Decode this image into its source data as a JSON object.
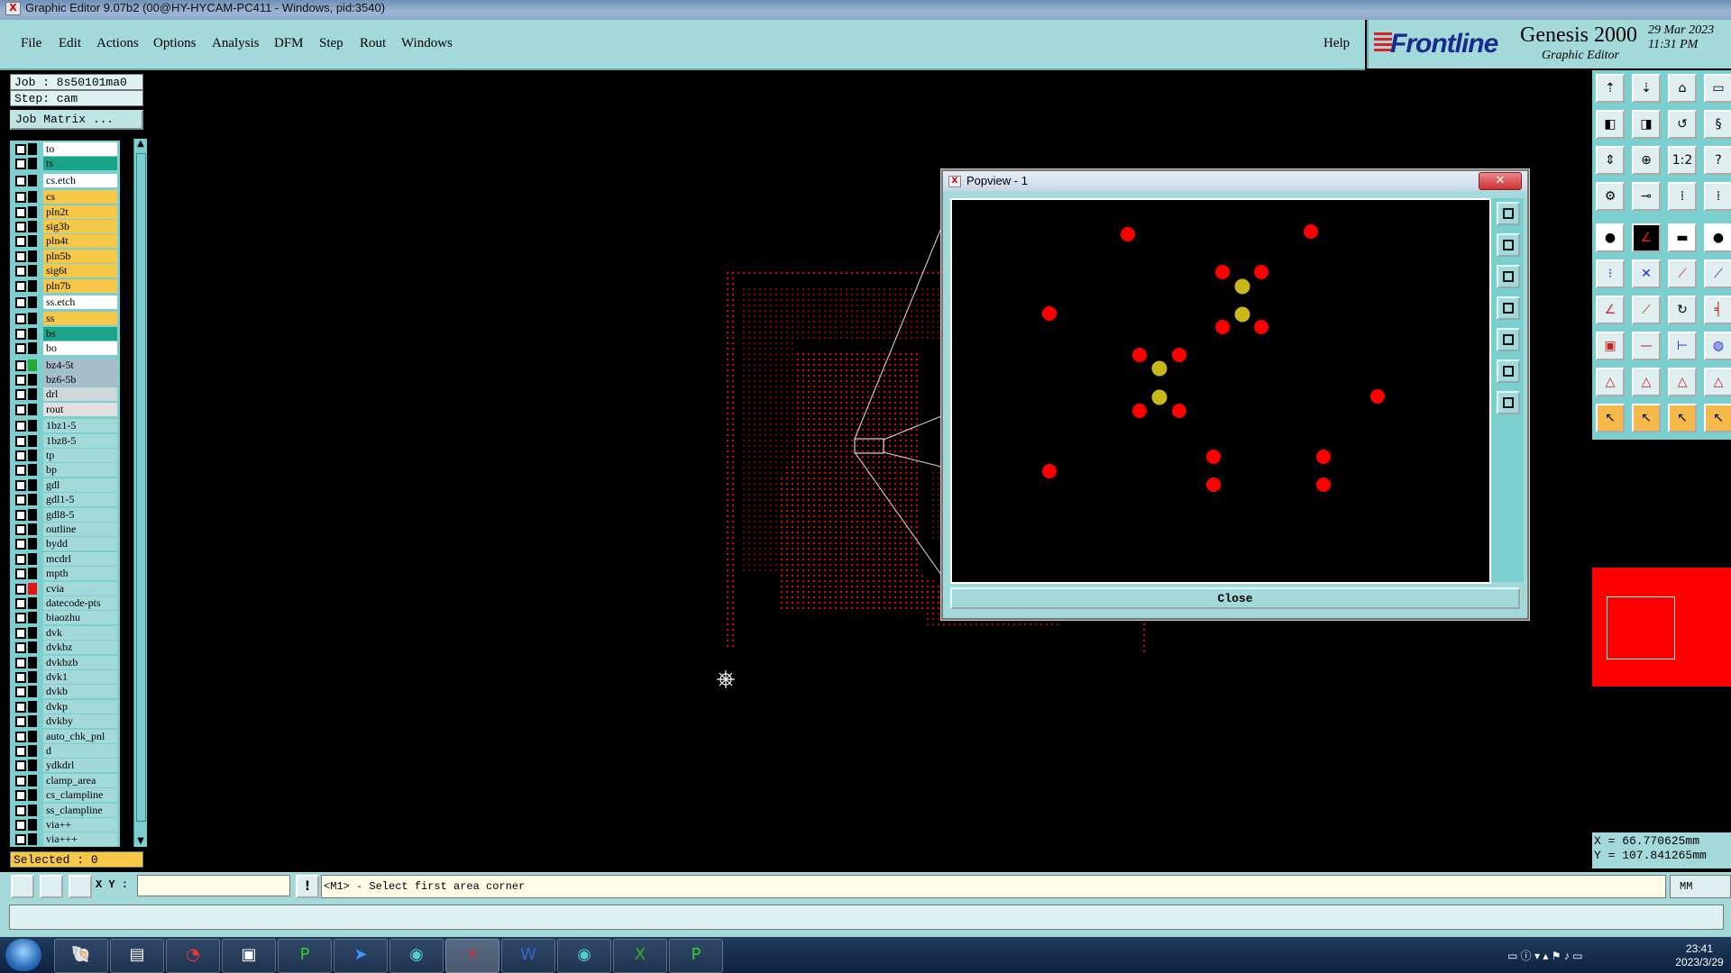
{
  "window": {
    "title": "Graphic Editor 9.07b2 (00@HY-HYCAM-PC411 - Windows, pid:3540)"
  },
  "menu": {
    "items": [
      "File",
      "Edit",
      "Actions",
      "Options",
      "Analysis",
      "DFM",
      "Step",
      "Rout",
      "Windows"
    ],
    "help": "Help"
  },
  "brand": {
    "logo": "Frontline",
    "product": "Genesis 2000",
    "subtitle": "Graphic Editor",
    "date": "29 Mar 2023",
    "time": "11:31 PM"
  },
  "job": {
    "job_label": "Job : 8s50101ma0",
    "step_label": "Step: cam",
    "matrix_button": "Job Matrix ..."
  },
  "layers": [
    {
      "name": "to",
      "color": "#ffffff"
    },
    {
      "name": "ts",
      "color": "#1aa58a"
    },
    {
      "name": "cs.etch",
      "color": "#ffffff",
      "gap": true
    },
    {
      "name": "cs",
      "color": "#f5c84a",
      "gap": true
    },
    {
      "name": "pln2t",
      "color": "#f5c84a"
    },
    {
      "name": "sig3b",
      "color": "#f5c84a"
    },
    {
      "name": "pln4t",
      "color": "#f5c84a"
    },
    {
      "name": "pln5b",
      "color": "#f5c84a"
    },
    {
      "name": "sig6t",
      "color": "#f5c84a"
    },
    {
      "name": "pln7b",
      "color": "#f5c84a"
    },
    {
      "name": "ss.etch",
      "color": "#ffffff",
      "gap": true
    },
    {
      "name": "ss",
      "color": "#f5c84a",
      "gap": true
    },
    {
      "name": "bs",
      "color": "#1aa58a"
    },
    {
      "name": "bo",
      "color": "#ffffff"
    },
    {
      "name": "bz4-5t",
      "color": "#a9bcc9",
      "gap": true,
      "swatch": "#22aa33"
    },
    {
      "name": "bz6-5b",
      "color": "#a9bcc9"
    },
    {
      "name": "drl",
      "color": "#cfd8d8"
    },
    {
      "name": "rout",
      "color": "#e0e0e0"
    },
    {
      "name": "1bz1-5",
      "color": "#a3d9d9",
      "gap": true
    },
    {
      "name": "1bz8-5",
      "color": "#a3d9d9"
    },
    {
      "name": "tp",
      "color": "#a3d9d9"
    },
    {
      "name": "bp",
      "color": "#a3d9d9"
    },
    {
      "name": "gdl",
      "color": "#a3d9d9"
    },
    {
      "name": "gdl1-5",
      "color": "#a3d9d9"
    },
    {
      "name": "gdl8-5",
      "color": "#a3d9d9"
    },
    {
      "name": "outline",
      "color": "#a3d9d9"
    },
    {
      "name": "bydd",
      "color": "#a3d9d9"
    },
    {
      "name": "mcdrl",
      "color": "#a3d9d9"
    },
    {
      "name": "mpth",
      "color": "#a3d9d9"
    },
    {
      "name": "cvia",
      "color": "#a3d9d9",
      "swatch": "#ee1111"
    },
    {
      "name": "datecode-pts",
      "color": "#a3d9d9"
    },
    {
      "name": "biaozhu",
      "color": "#a3d9d9"
    },
    {
      "name": "dvk",
      "color": "#a3d9d9"
    },
    {
      "name": "dvkbz",
      "color": "#a3d9d9"
    },
    {
      "name": "dvkbzb",
      "color": "#a3d9d9"
    },
    {
      "name": "dvk1",
      "color": "#a3d9d9"
    },
    {
      "name": "dvkb",
      "color": "#a3d9d9"
    },
    {
      "name": "dvkp",
      "color": "#a3d9d9"
    },
    {
      "name": "dvkby",
      "color": "#a3d9d9"
    },
    {
      "name": "auto_chk_pnl",
      "color": "#a3d9d9"
    },
    {
      "name": "d",
      "color": "#a3d9d9"
    },
    {
      "name": "ydkdrl",
      "color": "#a3d9d9"
    },
    {
      "name": "clamp_area",
      "color": "#a3d9d9"
    },
    {
      "name": "cs_clampline",
      "color": "#a3d9d9"
    },
    {
      "name": "ss_clampline",
      "color": "#a3d9d9"
    },
    {
      "name": "via++",
      "color": "#a3d9d9"
    },
    {
      "name": "via+++",
      "color": "#a3d9d9"
    }
  ],
  "selected": "Selected : 0",
  "popview": {
    "title": "Popview - 1",
    "close_label": "Close",
    "red_pads": [
      [
        195,
        38
      ],
      [
        398,
        35
      ],
      [
        108,
        126
      ],
      [
        300,
        80
      ],
      [
        343,
        80
      ],
      [
        300,
        141
      ],
      [
        343,
        141
      ],
      [
        208,
        172
      ],
      [
        252,
        172
      ],
      [
        208,
        234
      ],
      [
        252,
        234
      ],
      [
        472,
        218
      ],
      [
        290,
        285
      ],
      [
        412,
        285
      ],
      [
        108,
        301
      ],
      [
        290,
        316
      ],
      [
        412,
        316
      ]
    ],
    "yellow_pads": [
      [
        322,
        96
      ],
      [
        322,
        127
      ],
      [
        230,
        187
      ],
      [
        230,
        219
      ]
    ]
  },
  "coords": {
    "x": "X = 66.770625mm",
    "y": "Y = 107.841265mm"
  },
  "command": {
    "xy_label": "X Y :",
    "xy_value": "",
    "prompt": "<M1> - Select first area corner",
    "units": "MM"
  },
  "colors": {
    "accent_cyan": "#a3d9d9",
    "panel_cyan": "#7ccfcf",
    "pad_red": "#ff0000",
    "pad_yellow": "#c8b81a"
  },
  "taskbar": {
    "time": "23:41",
    "date": "2023/3/29",
    "apps": [
      "explorer",
      "notepad",
      "swirl",
      "save",
      "p-app",
      "arrow",
      "eye",
      "x-app",
      "word",
      "eye2",
      "excel",
      "p-app2"
    ]
  }
}
